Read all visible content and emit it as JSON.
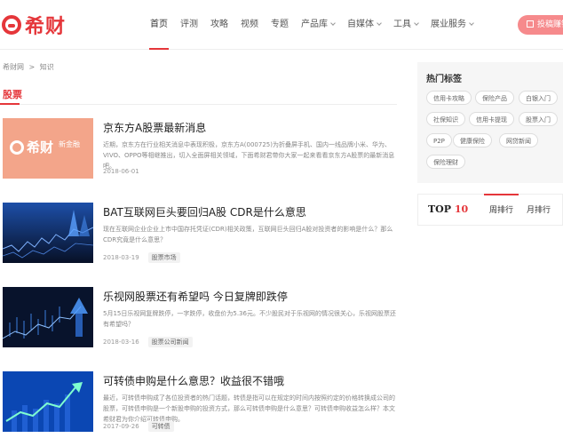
{
  "header": {
    "logo_text": "希财",
    "nav": [
      {
        "label": "首页",
        "active": true,
        "dropdown": false
      },
      {
        "label": "评测",
        "active": false,
        "dropdown": false
      },
      {
        "label": "攻略",
        "active": false,
        "dropdown": false
      },
      {
        "label": "视频",
        "active": false,
        "dropdown": false
      },
      {
        "label": "专题",
        "active": false,
        "dropdown": false
      },
      {
        "label": "产品库",
        "active": false,
        "dropdown": true
      },
      {
        "label": "自媒体",
        "active": false,
        "dropdown": true
      },
      {
        "label": "工具",
        "active": false,
        "dropdown": true
      },
      {
        "label": "展业服务",
        "active": false,
        "dropdown": true
      }
    ],
    "contribute_label": "投稿赚钱"
  },
  "breadcrumb": [
    "希财网",
    ">",
    "知识"
  ],
  "section_title": "股票",
  "articles": [
    {
      "title": "京东方A股票最新消息",
      "desc": "近期，京东方在行业相关消息中表现积极，京东方A(000725)为折叠屏手机、国内一线品牌小米、华为、VIVO、OPPO等相继推出，切入全面屏相关领域，下面希财君带你大家一起来看看京东方A股票的最新消息吧。",
      "date": "2018-06-01",
      "tag": "",
      "thumb": {
        "logo": "希财",
        "sub": "新金融"
      }
    },
    {
      "title": "BAT互联网巨头要回归A股 CDR是什么意思",
      "desc": "现在互联网企业企业上市中国存托凭证(CDR)相关政策，互联网巨头回归A股对投资者的影响是什么？那么CDR究竟是什么意思？",
      "date": "2018-03-19",
      "tag": "股票市场"
    },
    {
      "title": "乐视网股票还有希望吗 今日复牌即跌停",
      "desc": "5月15日乐视网复牌跌停，一字跌停，收盘价为5.36元。不少股民对于乐视网的情况很关心，乐视网股票还有希望吗？",
      "date": "2018-03-16",
      "tag": "股票公司新闻"
    },
    {
      "title": "可转债申购是什么意思？收益很不错哦",
      "desc": "最近，可转债申购成了各位投资者的热门话题，转债是指可以在规定的时间内按照约定的价格转换成公司的股票，可转债申购是一个新股申购的投资方式，那么可转债申购是什么意思？可转债申购收益怎么样？本文希财君为你介绍可转债申购。",
      "date": "2017-09-26",
      "tag": "可转债"
    }
  ],
  "sidebar": {
    "tags_title": "热门标签",
    "tags": [
      "信用卡攻略",
      "保险产品",
      "白银入门",
      "社保知识",
      "信用卡提现",
      "股票入门",
      "P2P",
      "健康保险",
      "网贷新闻",
      "保险理财"
    ],
    "top10_title": "TOP",
    "top10_num": "10",
    "tabs": [
      {
        "label": "周排行",
        "active": true
      },
      {
        "label": "月排行",
        "active": false
      }
    ]
  },
  "colors": {
    "accent": "#e5363a",
    "button": "#f68a8c"
  }
}
